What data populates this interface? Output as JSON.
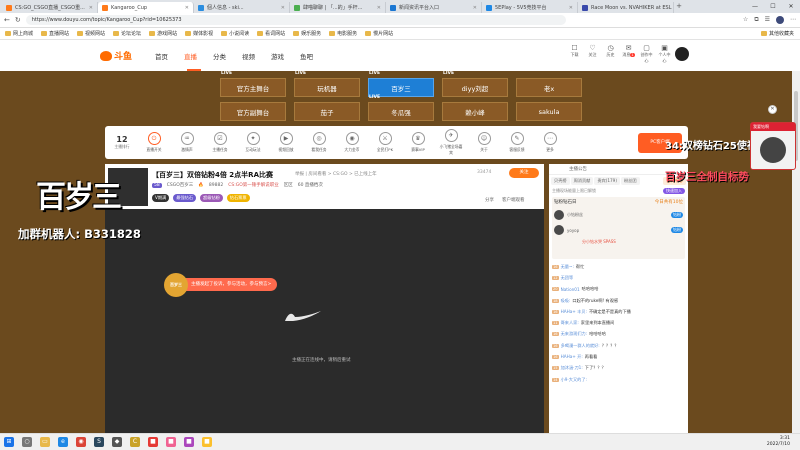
{
  "browser": {
    "tabs": [
      {
        "label": "CS:GO_CSGO直播_CSGO重...",
        "color": "#ff7a1a"
      },
      {
        "label": "Kangaroo_Cup",
        "color": "#ff7a1a",
        "active": true
      },
      {
        "label": "個人信息 - ski...",
        "color": "#2a8de0"
      },
      {
        "label": "肆喵聊聊 | 「...的」手杆...",
        "color": "#4caf50"
      },
      {
        "label": "新闻资讯平台入口",
        "color": "#1976d2"
      },
      {
        "label": "5EPlay - 5V5竞技平台",
        "color": "#1e88e5"
      },
      {
        "label": "Race Moon vs. NVAHIKER at ESL",
        "color": "#3949ab"
      }
    ],
    "url": "https://www.douyu.com/topic/Kangaroo_Cup?rid=10625373",
    "bookmarks": [
      "网上商城",
      "直播网站",
      "视频网站",
      "论坛论坛",
      "游戏网站",
      "媒体影视",
      "小说阅读",
      "看词网站",
      "娱乐服务",
      "电影服务",
      "慢片网站"
    ],
    "other_bookmarks": "其他收藏夹"
  },
  "site": {
    "logo": "斗鱼",
    "nav": [
      "首页",
      "直播",
      "分类",
      "视频",
      "游戏",
      "鱼吧"
    ],
    "active_nav": "直播",
    "header_icons": [
      {
        "glyph": "☐",
        "label": "下载",
        "badge": ""
      },
      {
        "glyph": "♡",
        "label": "关注",
        "badge": ""
      },
      {
        "glyph": "◷",
        "label": "历史",
        "badge": ""
      },
      {
        "glyph": "✉",
        "label": "消息",
        "badge": "1"
      },
      {
        "glyph": "▢",
        "label": "创作中心",
        "badge": ""
      },
      {
        "glyph": "▣",
        "label": "个人中心",
        "badge": ""
      }
    ]
  },
  "categories": [
    {
      "label": "官方主舞台",
      "live": true,
      "active": false
    },
    {
      "label": "玩机器",
      "live": true,
      "active": false
    },
    {
      "label": "百岁三",
      "live": true,
      "active": true
    },
    {
      "label": "diyy刘超",
      "live": true,
      "active": false
    },
    {
      "label": "老x",
      "live": false,
      "active": false
    },
    {
      "label": "官方副舞台",
      "live": false,
      "active": false
    },
    {
      "label": "茄子",
      "live": false,
      "active": false
    },
    {
      "label": "冬瓜强",
      "live": true,
      "active": false
    },
    {
      "label": "赖小峰",
      "live": false,
      "active": false
    },
    {
      "label": "sakula",
      "live": false,
      "active": false
    }
  ],
  "live_label": "LIVE",
  "func_bar": {
    "rank_num": "12",
    "rank_label": "主播排行",
    "items": [
      "直播开关",
      "激情声",
      "主播任务",
      "互动玩法",
      "视频回放",
      "看我任务",
      "大力金币",
      "全民打PK",
      "赛事VIP",
      "小飞猪全场嘉宾",
      "关于",
      "客服反馈",
      "更多"
    ],
    "pc_banner": "PC客户端"
  },
  "room": {
    "title": "【百岁三】双倍钻粉4倍 2点半RA比赛",
    "meta": "举报 | 房间看看 > CS:GO > 已上线上年",
    "level": "58",
    "game": "CSGO百岁三",
    "popularity": "89882",
    "medal": "CS:GO第一锤手解说职业",
    "rank_label": "区区",
    "viewers": "60 直播档次",
    "tags": [
      {
        "label": "V期满",
        "color": "#333"
      },
      {
        "label": "最强钻石",
        "color": "#6a5acd"
      },
      {
        "label": "超级钻粉",
        "color": "#9b59b6"
      },
      {
        "label": "钻石票票",
        "color": "#f0b400"
      }
    ],
    "follow_count": "33474",
    "follow_label": "关注",
    "share_labels": [
      "分享",
      "客户端观看"
    ]
  },
  "video": {
    "status": "主播正在连线中，请稍后重试",
    "promo": "主播发起了投诉，参与活动，参与预言>",
    "promo_crown": "百岁三"
  },
  "chat": {
    "top": "主播公告",
    "tabs": [
      "贝壳榜",
      "周消贡献",
      "贵宾(179)",
      "粉丝团"
    ],
    "extra_tab": "设计中心",
    "notice": "主播现场能量上限已解锁",
    "notice_action": "快速加入",
    "fans_title": "钻粉钻石日",
    "fans_highlight": "今日共有10位",
    "fans_users": [
      "小钻粉丝",
      "yoyop"
    ],
    "fans_badge": "钻粉",
    "fans_extra": "分小钻水哭 SPASS",
    "messages": [
      {
        "lv": "16",
        "user": "无量~: ",
        "text": "帮忙"
      },
      {
        "lv": "12",
        "user": "无团等",
        "text": ""
      },
      {
        "lv": "20",
        "user": "Nation01",
        "text": "哈哈哈哈"
      },
      {
        "lv": "18",
        "user": "吸吸:",
        "text": "口起不的ruke啊! 有观感"
      },
      {
        "lv": "16",
        "user": "HAHa+ 丰贝:",
        "text": "不确定是不是真的下播"
      },
      {
        "lv": "11",
        "user": "哥来人家:",
        "text": "家里来到本直播间"
      },
      {
        "lv": "16",
        "user": "无来游观们力:",
        "text": "哈哈哈哈"
      },
      {
        "lv": "16",
        "user": "多喝漫一群人的就好:",
        "text": "？？？？"
      },
      {
        "lv": "16",
        "user": "HAHa+ 开:",
        "text": "再看看"
      },
      {
        "lv": "15",
        "user": "加沐涵·刀1:",
        "text": "下了？？？"
      },
      {
        "lv": "14",
        "user": "小9·大又的了:",
        "text": ""
      }
    ]
  },
  "overlays": {
    "left_title": "百岁三",
    "left_sub": "加群机器人: B331828",
    "right_1": "34:双榜钻石25使视",
    "right_2": "百岁三全制自标势",
    "emote_header": "我要钻啊"
  },
  "taskbar": {
    "icons": [
      {
        "name": "start",
        "color": "#1a73e8",
        "glyph": "⊞"
      },
      {
        "name": "search",
        "color": "#777",
        "glyph": "○"
      },
      {
        "name": "files",
        "color": "#e8b84a",
        "glyph": "▭"
      },
      {
        "name": "edge",
        "color": "#1e88e5",
        "glyph": "e"
      },
      {
        "name": "chrome",
        "color": "#db4437",
        "glyph": "◉"
      },
      {
        "name": "steam",
        "color": "#2a475e",
        "glyph": "S"
      },
      {
        "name": "game",
        "color": "#555",
        "glyph": "◆"
      },
      {
        "name": "csgo",
        "color": "#c9a227",
        "glyph": "C"
      },
      {
        "name": "app1",
        "color": "#e53935",
        "glyph": "■"
      },
      {
        "name": "app2",
        "color": "#f06292",
        "glyph": "■"
      },
      {
        "name": "app3",
        "color": "#ab47bc",
        "glyph": "■"
      },
      {
        "name": "app4",
        "color": "#fbc02d",
        "glyph": "■"
      }
    ],
    "time": "3:31",
    "date": "2022/7/10"
  }
}
